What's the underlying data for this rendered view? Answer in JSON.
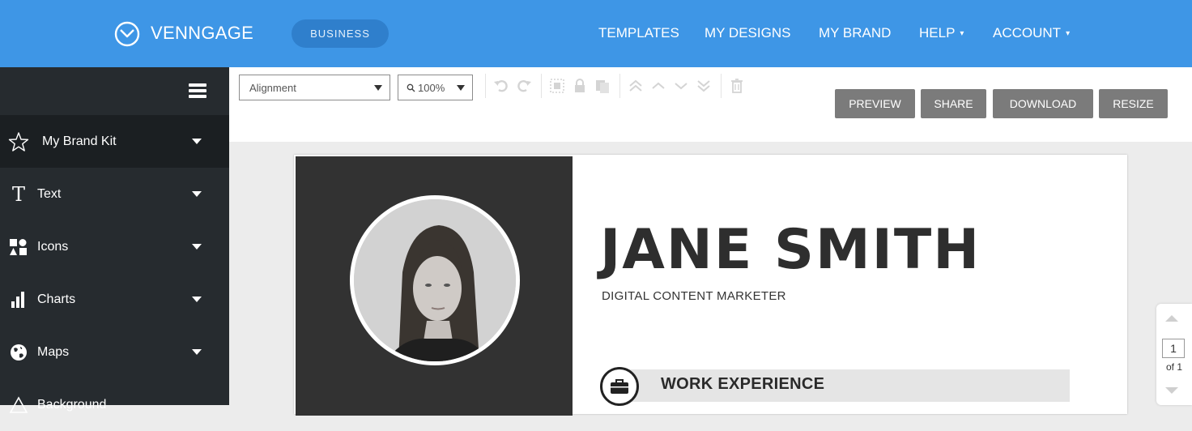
{
  "brand": {
    "name": "VENNGAGE",
    "plan": "BUSINESS"
  },
  "nav": [
    {
      "label": "TEMPLATES",
      "caret": ""
    },
    {
      "label": "MY DESIGNS",
      "caret": ""
    },
    {
      "label": "MY BRAND",
      "caret": ""
    },
    {
      "label": "HELP",
      "caret": "▾"
    },
    {
      "label": "ACCOUNT",
      "caret": "▾"
    }
  ],
  "sidebar": {
    "items": [
      {
        "label": "My Brand Kit",
        "icon": "star-icon"
      },
      {
        "label": "Text",
        "icon": "text-icon"
      },
      {
        "label": "Icons",
        "icon": "shapes-icon"
      },
      {
        "label": "Charts",
        "icon": "bar-chart-icon"
      },
      {
        "label": "Maps",
        "icon": "globe-icon"
      },
      {
        "label": "Background",
        "icon": "background-icon"
      }
    ]
  },
  "toolbar": {
    "alignment": "Alignment",
    "zoom": "100%",
    "tools": [
      "undo-icon",
      "redo-icon",
      "group-icon",
      "lock-icon",
      "duplicate-icon",
      "bring-to-front-icon",
      "bring-forward-icon",
      "send-backward-icon",
      "send-to-back-icon",
      "delete-icon"
    ],
    "buttons": {
      "preview": "PREVIEW",
      "share": "SHARE",
      "download": "DOWNLOAD",
      "resize": "RESIZE"
    }
  },
  "resume": {
    "name": "JANE SMITH",
    "role": "DIGITAL CONTENT MARKETER",
    "section_title": "WORK EXPERIENCE"
  },
  "pager": {
    "current": "1",
    "of": "of 1"
  },
  "colors": {
    "header": "#3e96e6",
    "sidebar": "#262b2f",
    "button": "#7b7b7b",
    "resume_dark": "#323232"
  }
}
